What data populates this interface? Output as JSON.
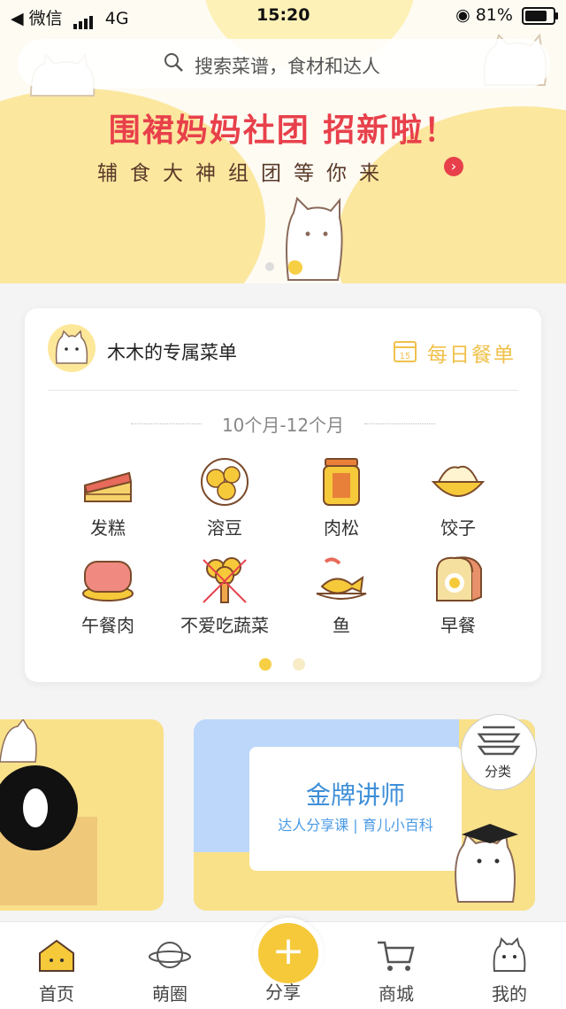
{
  "status_bar": {
    "carrier": "◀ 微信",
    "network": "4G",
    "time": "15:20",
    "battery": "81%"
  },
  "search": {
    "placeholder": "搜索菜谱，食材和达人"
  },
  "banner": {
    "title": "围裙妈妈社团 招新啦！",
    "subtitle": "辅食大神组团等你来"
  },
  "menu_card": {
    "title": "木木的专属菜单",
    "daily_label": "每日餐单",
    "calendar_day": "15",
    "age_range": "10个月-12个月",
    "categories": [
      {
        "label": "发糕",
        "icon": "cake-icon"
      },
      {
        "label": "溶豆",
        "icon": "lemon-icon"
      },
      {
        "label": "肉松",
        "icon": "floss-jar-icon"
      },
      {
        "label": "饺子",
        "icon": "dumpling-icon"
      },
      {
        "label": "午餐肉",
        "icon": "luncheon-meat-icon"
      },
      {
        "label": "不爱吃蔬菜",
        "icon": "broccoli-icon"
      },
      {
        "label": "鱼",
        "icon": "fish-icon"
      },
      {
        "label": "早餐",
        "icon": "toast-icon"
      }
    ]
  },
  "promo_right": {
    "title": "金牌讲师",
    "subtitle": "达人分享课 | 育儿小百科"
  },
  "classify_button": {
    "label": "分类"
  },
  "tabs": [
    {
      "label": "首页",
      "icon": "home-icon",
      "active": true
    },
    {
      "label": "萌圈",
      "icon": "planet-icon"
    },
    {
      "label": "分享",
      "icon": "plus-icon"
    },
    {
      "label": "商城",
      "icon": "cart-icon"
    },
    {
      "label": "我的",
      "icon": "cat-face-icon"
    }
  ],
  "colors": {
    "accent": "#f6c93a",
    "banner_red": "#e8404b",
    "blue": "#3f8fd8"
  }
}
